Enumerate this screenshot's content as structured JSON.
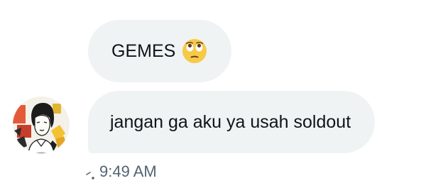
{
  "messages": [
    {
      "text": "GEMES",
      "emoji": "face-with-rolling-eyes-emoji"
    },
    {
      "text": "jangan ga aku ya usah soldout"
    }
  ],
  "meta": {
    "timestamp": "9:49 AM",
    "status_icon": "sent-status-icon"
  },
  "avatar": {
    "icon": "user-avatar-illustration"
  },
  "colors": {
    "bubble": "#eff3f4",
    "text": "#0f1419",
    "muted": "#536471",
    "emoji_face": "#f7c948"
  }
}
